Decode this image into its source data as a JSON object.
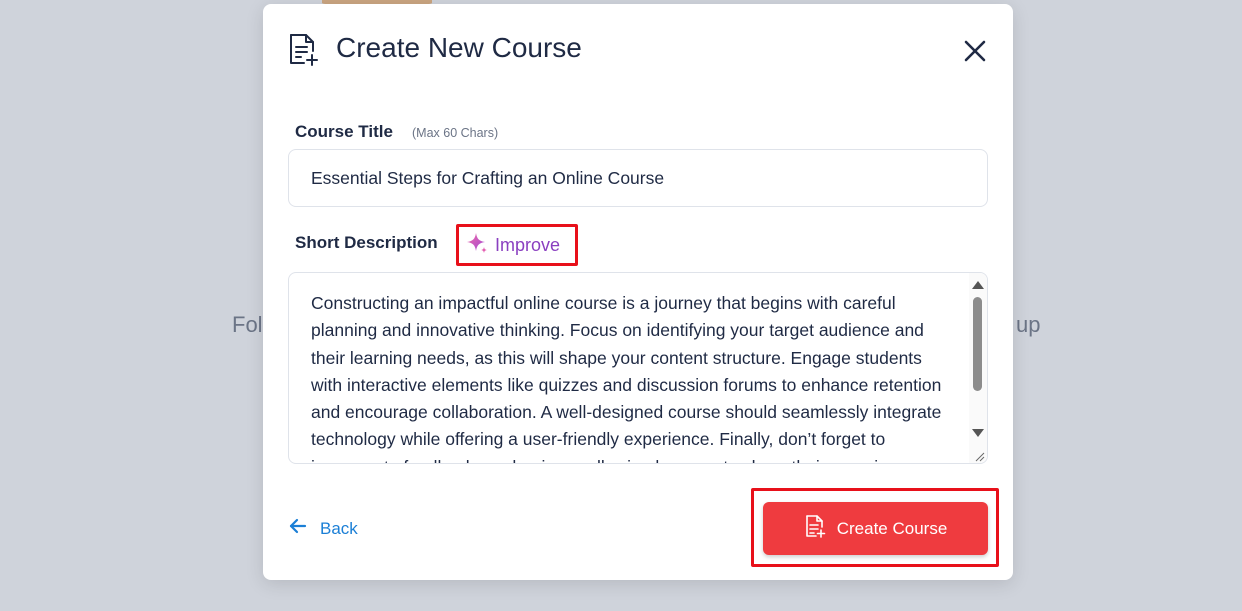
{
  "background": {
    "left_text": "Fol",
    "right_text": "up"
  },
  "modal": {
    "title": "Create New Course",
    "header_icon": "document-plus-icon",
    "close_icon": "close-icon"
  },
  "course_title": {
    "label": "Course Title",
    "hint": "(Max 60 Chars)",
    "value": "Essential Steps for Crafting an Online Course"
  },
  "short_description": {
    "label": "Short Description",
    "improve_label": "Improve",
    "improve_icon": "sparkle-icon",
    "value": "Constructing an impactful online course is a journey that begins with careful planning and innovative thinking. Focus on identifying your target audience and their learning needs, as this will shape your content structure. Engage students with interactive elements like quizzes and discussion forums to enhance retention and encourage collaboration. A well-designed course should seamlessly integrate technology while offering a user-friendly experience. Finally, don’t forget to incorporate feedback mechanisms, allowing learners to share their experiences and"
  },
  "footer": {
    "back_label": "Back",
    "back_icon": "arrow-left-icon",
    "create_label": "Create Course",
    "create_icon": "document-plus-icon"
  },
  "colors": {
    "accent_red": "#ef3b3f",
    "highlight_border": "#e8101a",
    "link_blue": "#1b7fd6",
    "improve_purple": "#8a3fc0",
    "text_dark": "#1f2a44"
  }
}
